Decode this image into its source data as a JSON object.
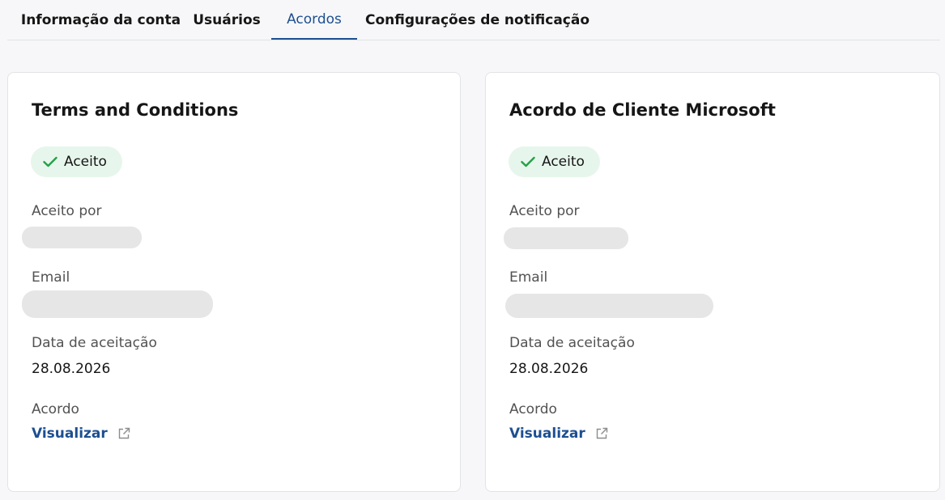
{
  "tabs": [
    {
      "label": "Informação da conta",
      "active": false
    },
    {
      "label": "Usuários",
      "active": false
    },
    {
      "label": "Acordos",
      "active": true
    },
    {
      "label": "Configurações de notificação",
      "active": false
    }
  ],
  "cards": [
    {
      "title": "Terms and Conditions",
      "status": "Aceito",
      "accepted_by_label": "Aceito por",
      "email_label": "Email",
      "date_label": "Data de aceitação",
      "date_value": "28.08.2026",
      "agreement_label": "Acordo",
      "link_text": "Visualizar"
    },
    {
      "title": "Acordo de Cliente Microsoft",
      "status": "Aceito",
      "accepted_by_label": "Aceito por",
      "email_label": "Email",
      "date_label": "Data de aceitação",
      "date_value": "28.08.2026",
      "agreement_label": "Acordo",
      "link_text": "Visualizar"
    }
  ],
  "colors": {
    "accent": "#1d4f91",
    "success": "#24a148",
    "success_bg": "#e7f6ec",
    "redaction": "#e6e6e6"
  },
  "icons": {
    "status": "checkmark-icon",
    "link": "external-link-icon"
  }
}
